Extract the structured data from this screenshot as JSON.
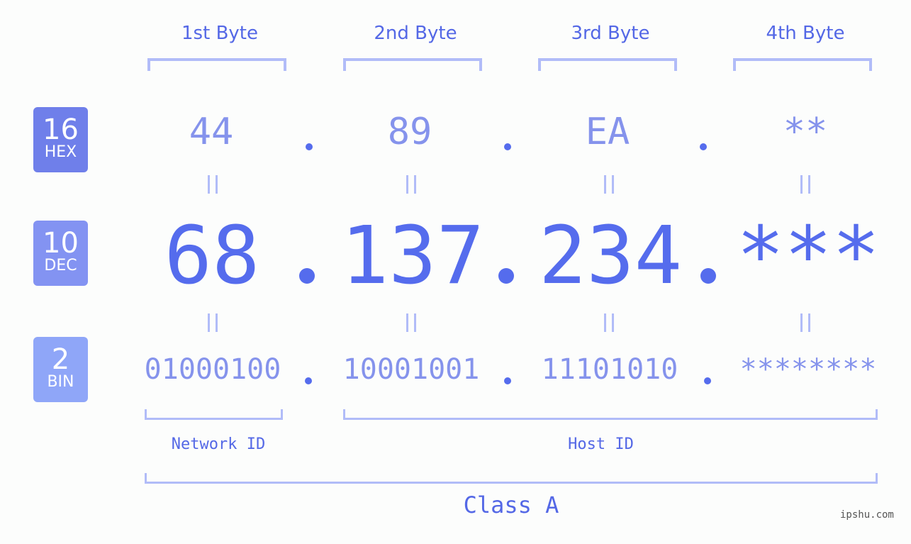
{
  "bytes": [
    {
      "header": "1st Byte",
      "hex": "44",
      "dec": "68",
      "bin": "01000100"
    },
    {
      "header": "2nd Byte",
      "hex": "89",
      "dec": "137",
      "bin": "10001001"
    },
    {
      "header": "3rd Byte",
      "hex": "EA",
      "dec": "234",
      "bin": "11101010"
    },
    {
      "header": "4th Byte",
      "hex": "**",
      "dec": "***",
      "bin": "********"
    }
  ],
  "badges": {
    "hex": {
      "num": "16",
      "label": "HEX",
      "color": "#6f7fea"
    },
    "dec": {
      "num": "10",
      "label": "DEC",
      "color": "#8393f2"
    },
    "bin": {
      "num": "2",
      "label": "BIN",
      "color": "#8fa6f8"
    }
  },
  "ids": {
    "network": "Network ID",
    "host": "Host ID"
  },
  "class_label": "Class A",
  "watermark": "ipshu.com",
  "colors": {
    "primary": "#556ced",
    "light": "#8593ec",
    "bracket": "#b1bcf8"
  }
}
